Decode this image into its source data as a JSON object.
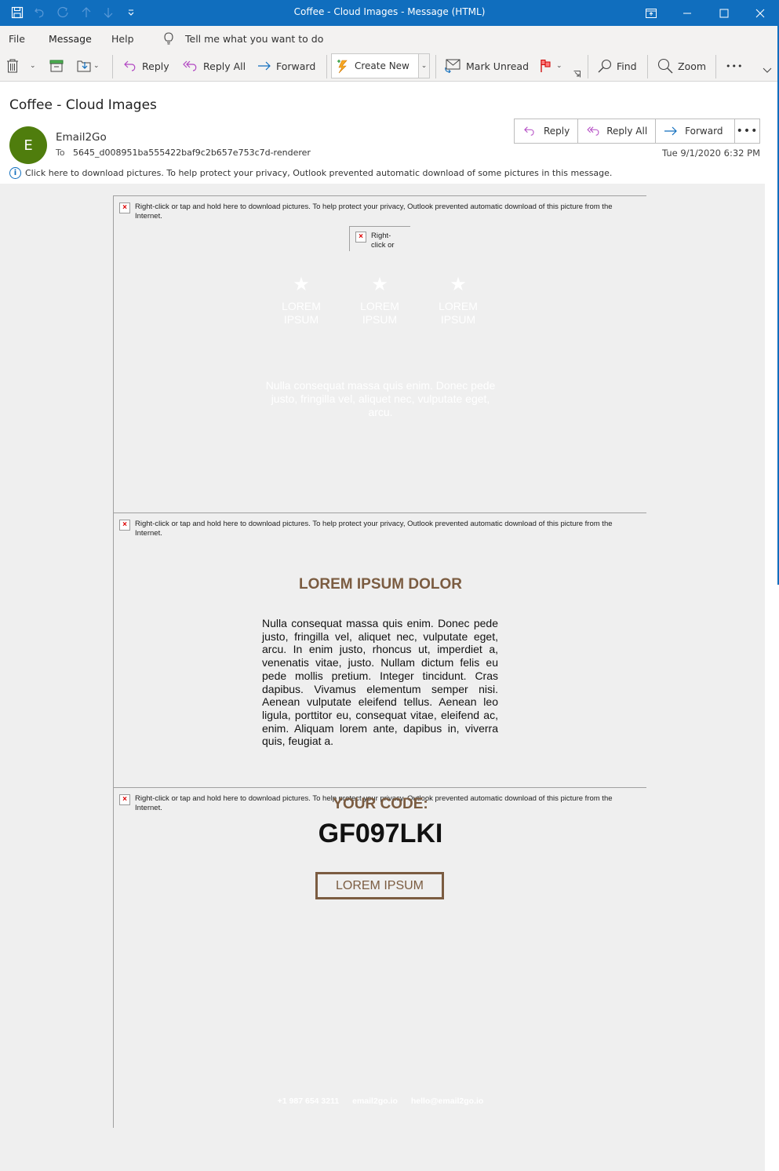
{
  "window": {
    "title": "Coffee - Cloud Images  -  Message (HTML)",
    "accent_color": "#106ebe"
  },
  "quick_access": {
    "icons": [
      "save-icon",
      "undo-icon",
      "redo-icon",
      "up-arrow-icon",
      "down-arrow-icon",
      "customize-toolbar-icon"
    ]
  },
  "menu": {
    "items": [
      {
        "label": "File",
        "active": false
      },
      {
        "label": "Message",
        "active": true
      },
      {
        "label": "Help",
        "active": false
      }
    ],
    "tell_me": "Tell me what you want to do"
  },
  "ribbon": {
    "delete_icon": "trash-icon",
    "archive_icon": "archive-icon",
    "move_icon": "move-to-folder-icon",
    "reply": "Reply",
    "reply_all": "Reply All",
    "forward": "Forward",
    "create_new": "Create New",
    "mark_unread": "Mark Unread",
    "find": "Find",
    "zoom": "Zoom",
    "more": "•••"
  },
  "message": {
    "subject": "Coffee - Cloud Images",
    "avatar_initial": "E",
    "avatar_color": "#4f7d0d",
    "sender": "Email2Go",
    "to_label": "To",
    "to_value": "5645_d008951ba555422baf9c2b657e753c7d-renderer",
    "date": "Tue 9/1/2020 6:32 PM",
    "info_text": "Click here to download pictures. To help protect your privacy, Outlook prevented automatic download of some pictures in this message.",
    "actions": {
      "reply": "Reply",
      "reply_all": "Reply All",
      "forward": "Forward",
      "more": "•••"
    }
  },
  "email_body": {
    "image_warning": "Right-click or tap and hold here to download pictures. To help protect your privacy, Outlook prevented automatic download of this picture from the Internet.",
    "small_image_warning": "Right-click or",
    "features": [
      {
        "icon": "★",
        "label": "LOREM IPSUM"
      },
      {
        "icon": "★",
        "label": "LOREM IPSUM"
      },
      {
        "icon": "★",
        "label": "LOREM IPSUM"
      }
    ],
    "intro_text": "Nulla consequat massa quis enim. Donec pede justo, fringilla vel, aliquet nec, vulputate eget, arcu.",
    "section_heading": "LOREM IPSUM DOLOR",
    "section_text": "Nulla consequat massa quis enim. Donec pede justo, fringilla vel, aliquet nec, vulputate eget, arcu. In enim justo, rhoncus ut, imperdiet a, venenatis vitae, justo. Nullam dictum felis eu pede mollis pretium. Integer tincidunt. Cras dapibus. Vivamus elementum semper nisi. Aenean vulputate eleifend tellus. Aenean leo ligula, porttitor eu, consequat vitae, eleifend ac, enim. Aliquam lorem ante, dapibus in, viverra quis, feugiat a.",
    "code_label": "YOUR CODE:",
    "code_value": "GF097LKI",
    "cta_label": "LOREM IPSUM",
    "brand_color": "#7b5c41",
    "footer": {
      "phone": "+1 987 654 3211",
      "website": "email2go.io",
      "email": "hello@email2go.io"
    }
  }
}
